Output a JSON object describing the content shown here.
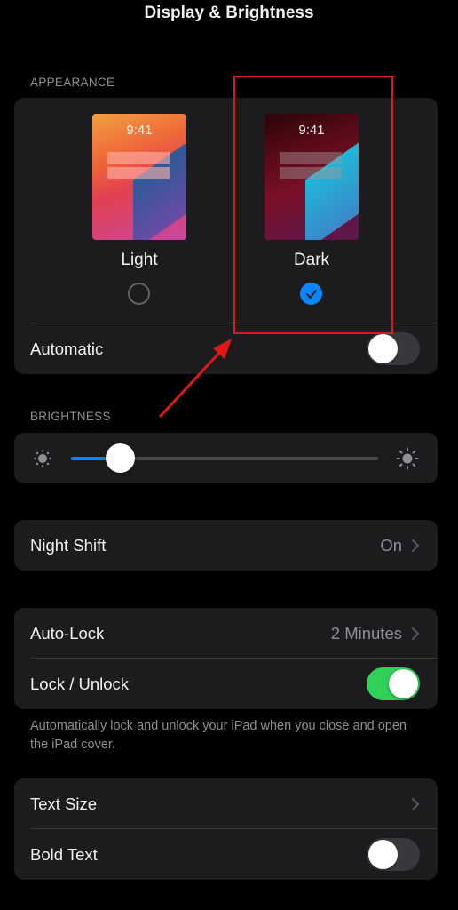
{
  "header": {
    "title": "Display & Brightness"
  },
  "appearance": {
    "section_title": "APPEARANCE",
    "preview_time": "9:41",
    "options": [
      {
        "label": "Light",
        "selected": false
      },
      {
        "label": "Dark",
        "selected": true
      }
    ],
    "automatic": {
      "label": "Automatic",
      "on": false
    }
  },
  "brightness": {
    "section_title": "BRIGHTNESS",
    "level": 0.16,
    "min_icon": "sun-small-icon",
    "max_icon": "sun-large-icon"
  },
  "night_shift": {
    "label": "Night Shift",
    "value": "On"
  },
  "lock": {
    "auto_lock": {
      "label": "Auto-Lock",
      "value": "2 Minutes"
    },
    "lock_unlock": {
      "label": "Lock / Unlock",
      "on": true
    },
    "footer": "Automatically lock and unlock your iPad when you close and open the iPad cover."
  },
  "text": {
    "text_size": {
      "label": "Text Size"
    },
    "bold_text": {
      "label": "Bold Text",
      "on": false
    }
  },
  "colors": {
    "accent": "#0a84ff",
    "toggle_on": "#30d158",
    "annotation": "#e01818"
  },
  "annotation": {
    "highlight": "Dark appearance option"
  }
}
